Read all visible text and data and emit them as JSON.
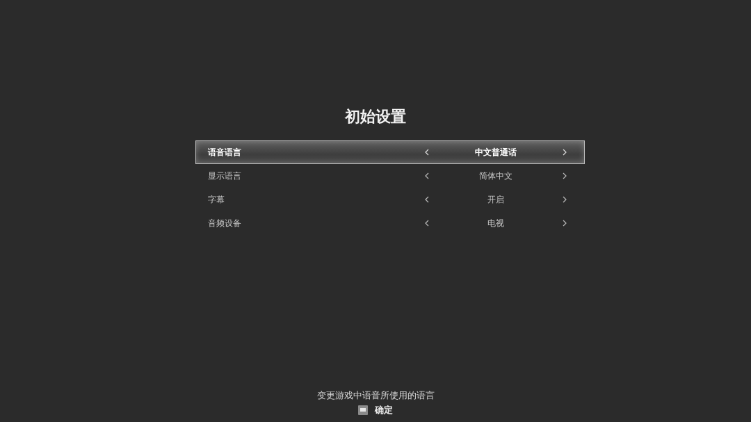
{
  "title": "初始设置",
  "settings": [
    {
      "label": "语音语言",
      "value": "中文普通话",
      "selected": true
    },
    {
      "label": "显示语言",
      "value": "简体中文",
      "selected": false
    },
    {
      "label": "字幕",
      "value": "开启",
      "selected": false
    },
    {
      "label": "音频设备",
      "value": "电视",
      "selected": false
    }
  ],
  "description": "变更游戏中语音所使用的语言",
  "hints": [
    {
      "label": "确定"
    }
  ]
}
